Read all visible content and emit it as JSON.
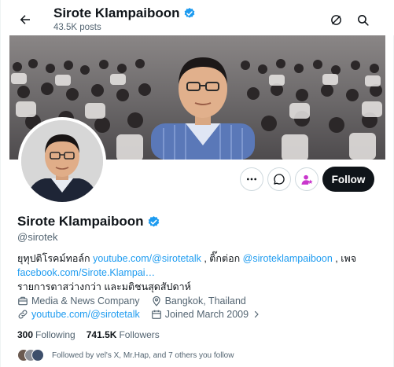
{
  "header": {
    "name": "Sirote Klampaiboon",
    "posts_count": "43.5K posts"
  },
  "profile": {
    "name": "Sirote Klampaiboon",
    "handle": "@sirotek",
    "bio": {
      "line1_prefix": "ยุทุปติโรคม์ทอล์ก ",
      "line1_link1": "youtube.com/@sirotetalk",
      "line1_mid": " , ติ๊กต่อก ",
      "line1_link2": "@siroteklampaiboon",
      "line1_suffix": " , เพจ",
      "line2_link": "facebook.com/Sirote.Klampai…",
      "line3": "รายการตาสว่างกว่า และมติชนสุดสัปดาห์"
    },
    "category": "Media & News Company",
    "location": "Bangkok, Thailand",
    "website": "youtube.com/@sirotetalk",
    "joined": "Joined March 2009",
    "following_count": "300",
    "following_label": "Following",
    "followers_count": "741.5K",
    "followers_label": "Followers",
    "followed_by": "Followed by vel's X, Mr.Hap, and 7 others you follow"
  },
  "actions": {
    "follow_label": "Follow"
  },
  "colors": {
    "accent": "#1d9bf0",
    "follow_bg": "#0f1419",
    "subscribe": "#c936cc",
    "muted": "#536471"
  },
  "icons": [
    "back-arrow-icon",
    "grok-icon",
    "search-icon",
    "verified-badge-icon",
    "more-icon",
    "message-icon",
    "subscribe-icon",
    "briefcase-icon",
    "location-icon",
    "link-icon",
    "calendar-icon",
    "chevron-right-icon"
  ]
}
